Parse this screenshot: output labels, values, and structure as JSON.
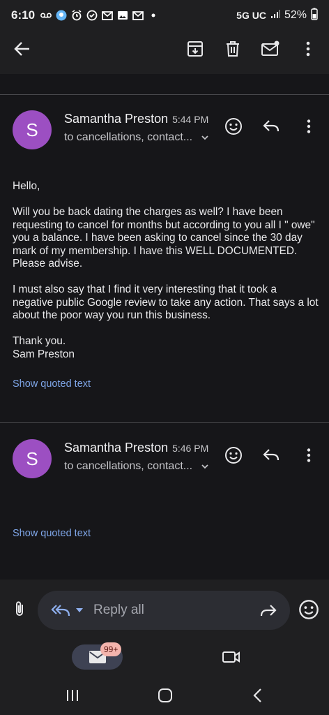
{
  "status_bar": {
    "time": "6:10",
    "network": "5G UC",
    "battery": "52%",
    "notification_icons": [
      "voicemail-icon",
      "app-icon",
      "alarm-icon",
      "sync-icon",
      "gmail-icon",
      "photos-icon",
      "gmail-icon",
      "dot-icon"
    ]
  },
  "toolbar": {
    "icons": [
      "back-arrow-icon",
      "archive-icon",
      "delete-icon",
      "mark-unread-icon",
      "more-vert-icon"
    ]
  },
  "messages": [
    {
      "avatar_letter": "S",
      "sender": "Samantha Preston",
      "time": "5:44 PM",
      "recipients": "to cancellations, contact...",
      "body": [
        "Hello,",
        "Will you be back dating the charges as well?   I have been requesting to cancel for months but according to you all I \" owe\" you a balance. I have been asking to cancel since the 30 day mark of my membership. I have this WELL DOCUMENTED.  Please advise.",
        "I must also say that I find it very interesting that it took a negative public Google review to take any action. That says a lot about the poor way you run this business.",
        "Thank you.\nSam Preston"
      ],
      "quoted_link": "Show quoted text"
    },
    {
      "avatar_letter": "S",
      "sender": "Samantha Preston",
      "time": "5:46 PM",
      "recipients": "to cancellations, contact...",
      "quoted_link": "Show quoted text"
    }
  ],
  "reply_bar": {
    "label": "Reply all"
  },
  "bottom_nav": {
    "mail_badge": "99+"
  },
  "colors": {
    "background": "#161619",
    "chrome": "#1f1f21",
    "avatar": "#9c4fc2",
    "link": "#7fa6e8",
    "reply_pill": "#2c2d33",
    "badge": "#f3b4ad"
  }
}
